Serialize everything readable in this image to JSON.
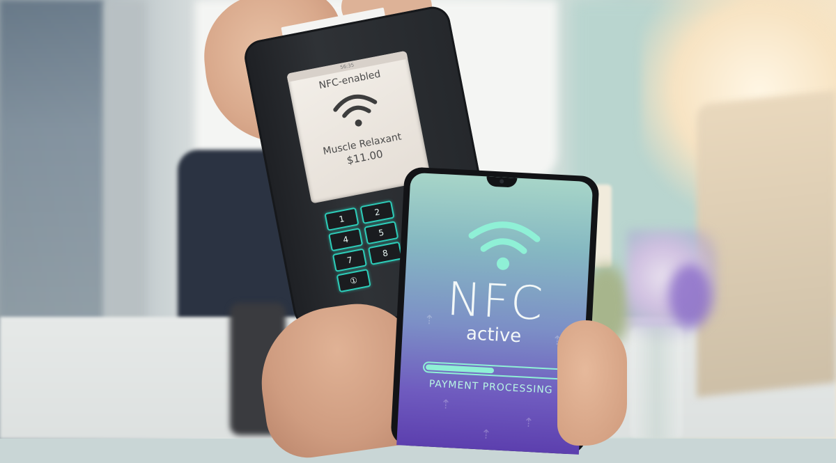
{
  "terminal": {
    "status": "56:35",
    "header": "NFC-enabled",
    "item": "Muscle Relaxant",
    "price": "$11.00",
    "keys": [
      "1",
      "2",
      "4",
      "5",
      "7",
      "8",
      "①"
    ]
  },
  "phone": {
    "title": "NFC",
    "subtitle": "active",
    "status": "PAYMENT PROCESSING",
    "progress": 0.5
  },
  "colors": {
    "accent": "#8ff0d6",
    "keypad_glow": "#2dcdb9",
    "screen_top": "#a7d5c8",
    "screen_bottom": "#5c3fae"
  },
  "icons": {
    "terminal": "wifi-icon",
    "phone": "wifi-icon"
  }
}
